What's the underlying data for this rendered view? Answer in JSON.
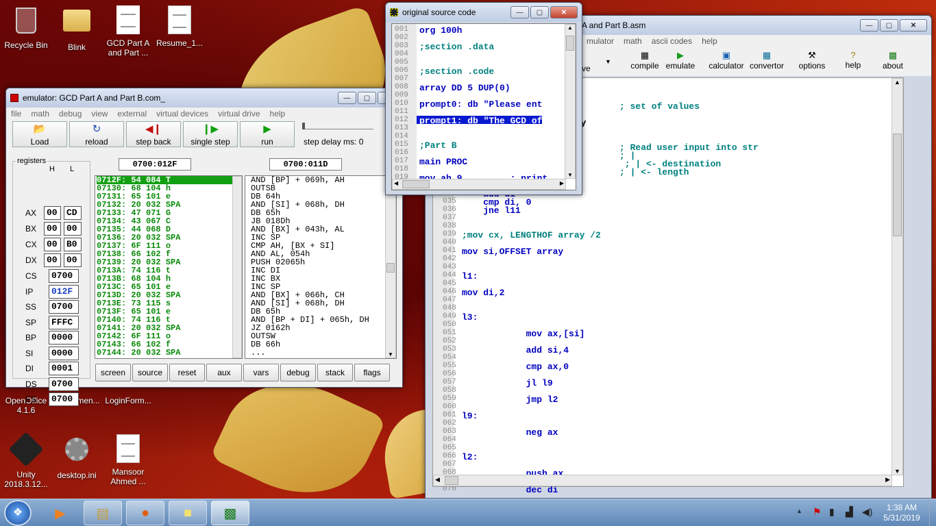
{
  "desktop": {
    "icons": [
      {
        "label": "Recycle Bin"
      },
      {
        "label": "Blink"
      },
      {
        "label": "GCD Part  A and Part ..."
      },
      {
        "label": "Resume_1..."
      },
      {
        "label": "OpenOffice 4.1.6"
      },
      {
        "label": "Attachmen..."
      },
      {
        "label": "LoginForm..."
      },
      {
        "label": "Unity 2018.3.12..."
      },
      {
        "label": "desktop.ini"
      },
      {
        "label": "Mansoor Ahmed ..."
      }
    ]
  },
  "emulator": {
    "title": "emulator: GCD Part  A and Part B.com_",
    "menu": [
      "file",
      "math",
      "debug",
      "view",
      "external",
      "virtual devices",
      "virtual drive",
      "help"
    ],
    "toolbar": {
      "load": "Load",
      "reload": "reload",
      "step_back": "step back",
      "single_step": "single step",
      "run": "run",
      "step_delay": "step delay ms: 0"
    },
    "registers_label": "registers",
    "h_label": "H",
    "l_label": "L",
    "regs8": [
      {
        "name": "AX",
        "h": "00",
        "l": "CD"
      },
      {
        "name": "BX",
        "h": "00",
        "l": "00"
      },
      {
        "name": "CX",
        "h": "00",
        "l": "B0"
      },
      {
        "name": "DX",
        "h": "00",
        "l": "00"
      }
    ],
    "regs16": [
      {
        "name": "CS",
        "v": "0700"
      },
      {
        "name": "IP",
        "v": "012F"
      },
      {
        "name": "SS",
        "v": "0700"
      },
      {
        "name": "SP",
        "v": "FFFC"
      },
      {
        "name": "BP",
        "v": "0000"
      },
      {
        "name": "SI",
        "v": "0000"
      },
      {
        "name": "DI",
        "v": "0001"
      },
      {
        "name": "DS",
        "v": "0700"
      },
      {
        "name": "ES",
        "v": "0700"
      }
    ],
    "addr_left": "0700:012F",
    "addr_right": "0700:011D",
    "memory": [
      "0712F: 54 084 T",
      "07130: 68 104 h",
      "07131: 65 101 e",
      "07132: 20 032 SPA",
      "07133: 47 071 G",
      "07134: 43 067 C",
      "07135: 44 068 D",
      "07136: 20 032 SPA",
      "07137: 6F 111 o",
      "07138: 66 102 f",
      "07139: 20 032 SPA",
      "0713A: 74 116 t",
      "0713B: 68 104 h",
      "0713C: 65 101 e",
      "0713D: 20 032 SPA",
      "0713E: 73 115 s",
      "0713F: 65 101 e",
      "07140: 74 116 t",
      "07141: 20 032 SPA",
      "07142: 6F 111 o",
      "07143: 66 102 f",
      "07144: 20 032 SPA"
    ],
    "disasm": [
      "AND [BP] + 069h, AH",
      "OUTSB",
      "DB 64h",
      "AND [SI] + 068h, DH",
      "DB 65h",
      "JB 018Dh",
      "AND [BX] + 043h, AL",
      "INC SP",
      "CMP AH, [BX + SI]",
      "AND AL, 054h",
      "PUSH 02065h",
      "INC DI",
      "INC BX",
      "INC SP",
      "AND [BX] + 066h, CH",
      "AND [SI] + 068h, DH",
      "DB 65h",
      "AND [BP + DI] + 065h, DH",
      "JZ 0162h",
      "OUTSW",
      "DB 66h",
      "..."
    ],
    "bottom": [
      "screen",
      "source",
      "reset",
      "aux",
      "vars",
      "debug",
      "stack",
      "flags"
    ]
  },
  "source": {
    "title": "original source code",
    "lines": [
      {
        "n": "001",
        "t": "org 100h"
      },
      {
        "n": "002",
        "t": ""
      },
      {
        "n": "003",
        "t": ";section .data"
      },
      {
        "n": "004",
        "t": ""
      },
      {
        "n": "005",
        "t": ""
      },
      {
        "n": "006",
        "t": ";section .code"
      },
      {
        "n": "007",
        "t": ""
      },
      {
        "n": "008",
        "t": "array DD 5 DUP(0)"
      },
      {
        "n": "009",
        "t": ""
      },
      {
        "n": "010",
        "t": "prompt0: db \"Please ent"
      },
      {
        "n": "011",
        "t": ""
      },
      {
        "n": "012",
        "t": "prompt1: db \"The GCD of"
      },
      {
        "n": "013",
        "t": ""
      },
      {
        "n": "014",
        "t": ""
      },
      {
        "n": "015",
        "t": ";Part B"
      },
      {
        "n": "016",
        "t": ""
      },
      {
        "n": "017",
        "t": "main PROC"
      },
      {
        "n": "018",
        "t": ""
      },
      {
        "n": "019",
        "t": "mov ah,9         ; print"
      }
    ]
  },
  "editor": {
    "title": "A and Part B.asm",
    "menu": [
      "mulator",
      "math",
      "ascii codes",
      "help"
    ],
    "toolbar": [
      "ve",
      "compile",
      "emulate",
      "calculator",
      "convertor",
      "options",
      "help",
      "about"
    ],
    "top_lines": [
      {
        "t": "; set of values"
      },
      {
        "t": "ray"
      },
      {
        "t": "; Read user input into str"
      },
      {
        "t": "; |"
      },
      {
        "t": " ; | <- destination"
      },
      {
        "t": "; | <- length"
      }
    ],
    "lines": [
      {
        "n": "034",
        "t": "    add di"
      },
      {
        "n": "035",
        "t": "    cmp di, 0"
      },
      {
        "n": "036",
        "t": "    jne l11"
      },
      {
        "n": "037",
        "t": ""
      },
      {
        "n": "038",
        "t": ""
      },
      {
        "n": "039",
        "t": ";mov cx, LENGTHOF array /2"
      },
      {
        "n": "040",
        "t": ""
      },
      {
        "n": "041",
        "t": "mov si,OFFSET array"
      },
      {
        "n": "042",
        "t": ""
      },
      {
        "n": "043",
        "t": ""
      },
      {
        "n": "044",
        "t": "l1:"
      },
      {
        "n": "045",
        "t": ""
      },
      {
        "n": "046",
        "t": "mov di,2"
      },
      {
        "n": "047",
        "t": ""
      },
      {
        "n": "048",
        "t": ""
      },
      {
        "n": "049",
        "t": "l3:"
      },
      {
        "n": "050",
        "t": ""
      },
      {
        "n": "051",
        "t": "            mov ax,[si]"
      },
      {
        "n": "052",
        "t": ""
      },
      {
        "n": "053",
        "t": "            add si,4"
      },
      {
        "n": "054",
        "t": ""
      },
      {
        "n": "055",
        "t": "            cmp ax,0"
      },
      {
        "n": "056",
        "t": ""
      },
      {
        "n": "057",
        "t": "            jl l9"
      },
      {
        "n": "058",
        "t": ""
      },
      {
        "n": "059",
        "t": "            jmp l2"
      },
      {
        "n": "060",
        "t": ""
      },
      {
        "n": "061",
        "t": "l9:"
      },
      {
        "n": "062",
        "t": ""
      },
      {
        "n": "063",
        "t": "            neg ax"
      },
      {
        "n": "064",
        "t": ""
      },
      {
        "n": "065",
        "t": ""
      },
      {
        "n": "066",
        "t": "l2:"
      },
      {
        "n": "067",
        "t": ""
      },
      {
        "n": "068",
        "t": "            push ax"
      },
      {
        "n": "069",
        "t": ""
      },
      {
        "n": "070",
        "t": "            dec di"
      }
    ]
  },
  "taskbar": {
    "time": "1:38 AM",
    "date": "5/31/2019"
  }
}
